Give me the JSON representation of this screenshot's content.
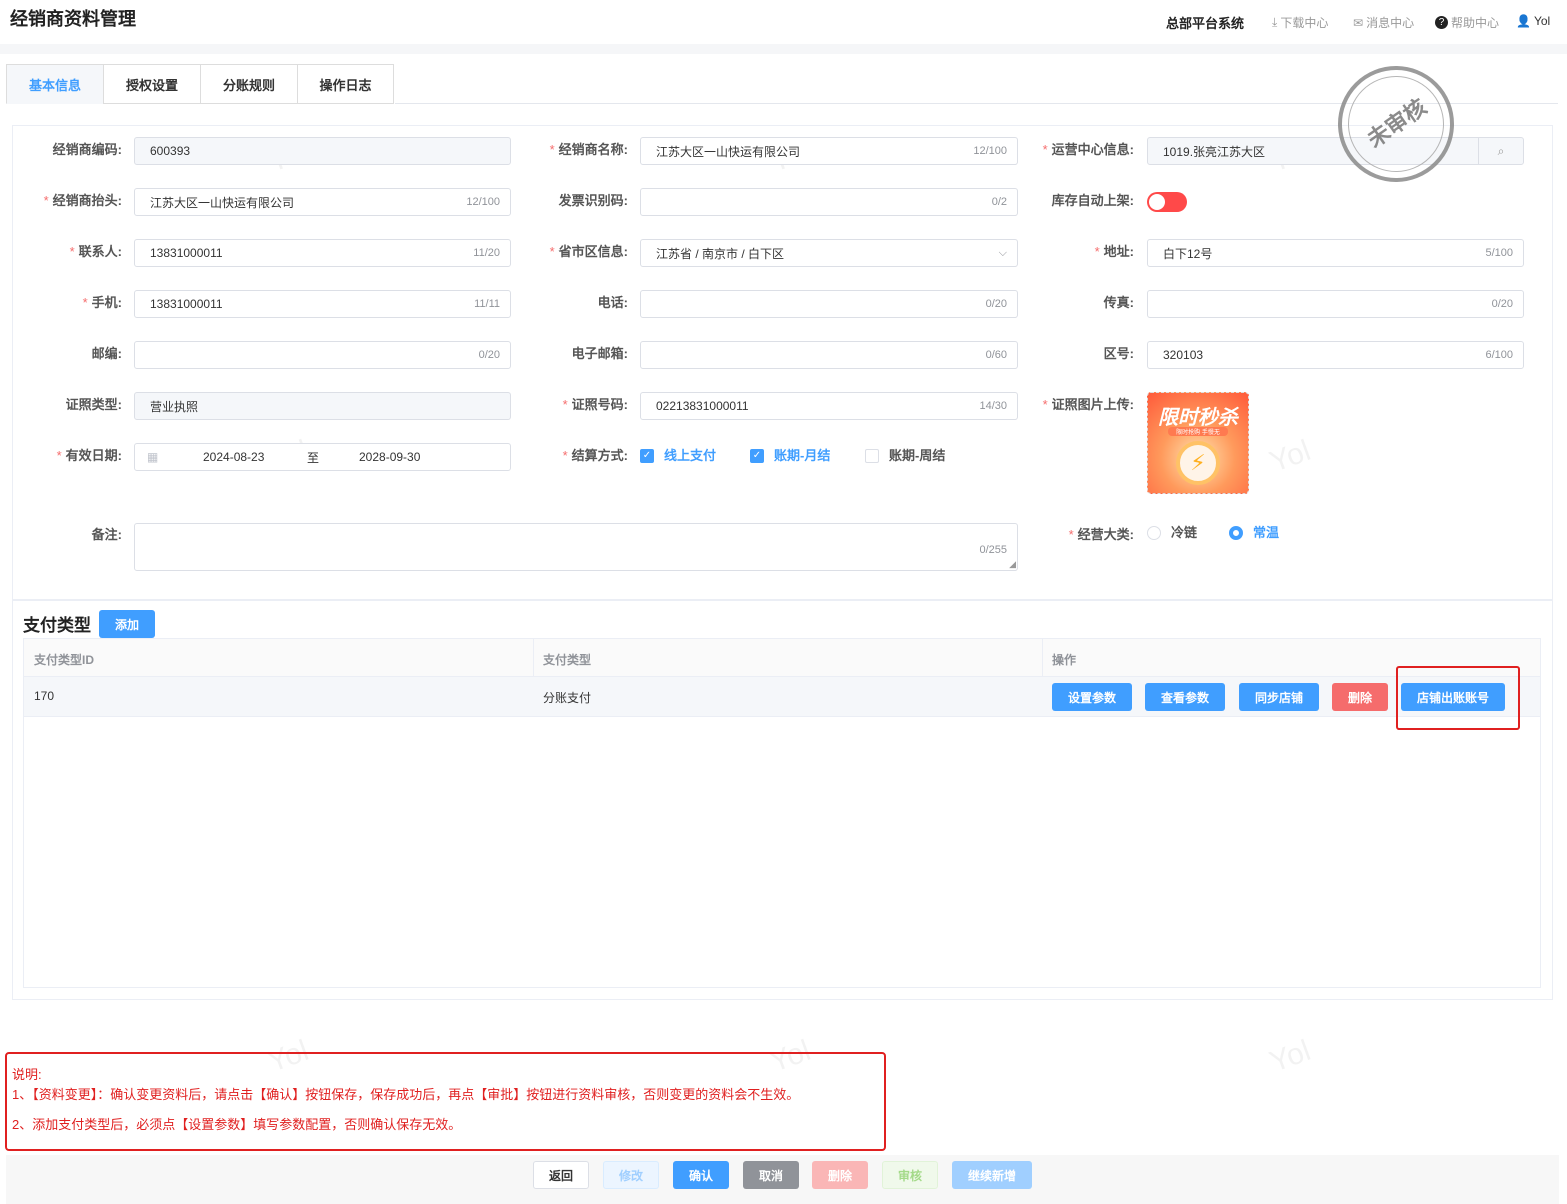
{
  "header": {
    "title": "经销商资料管理",
    "system": "总部平台系统",
    "download": "下载中心",
    "messages": "消息中心",
    "help": "帮助中心",
    "user": "Yol"
  },
  "tabs": [
    {
      "label": "基本信息",
      "active": true
    },
    {
      "label": "授权设置"
    },
    {
      "label": "分账规则"
    },
    {
      "label": "操作日志"
    }
  ],
  "stamp": "未审核",
  "watermark": "Yol",
  "form": {
    "dealer_code": {
      "label": "经销商编码:",
      "value": "600393"
    },
    "dealer_name": {
      "label": "经销商名称:",
      "value": "江苏大区一山快运有限公司",
      "count": "12/100"
    },
    "ops_center": {
      "label": "运营中心信息:",
      "value": "1019.张亮江苏大区"
    },
    "dealer_header": {
      "label": "经销商抬头:",
      "value": "江苏大区一山快运有限公司",
      "count": "12/100"
    },
    "invoice_code": {
      "label": "发票识别码:",
      "value": "",
      "count": "0/2"
    },
    "auto_shelf": {
      "label": "库存自动上架:",
      "on": false
    },
    "contact": {
      "label": "联系人:",
      "value": "13831000011",
      "count": "11/20"
    },
    "region": {
      "label": "省市区信息:",
      "value": "江苏省 / 南京市 / 白下区"
    },
    "address": {
      "label": "地址:",
      "value": "白下12号",
      "count": "5/100"
    },
    "mobile": {
      "label": "手机:",
      "value": "13831000011",
      "count": "11/11"
    },
    "phone": {
      "label": "电话:",
      "value": "",
      "count": "0/20"
    },
    "fax": {
      "label": "传真:",
      "value": "",
      "count": "0/20"
    },
    "postcode": {
      "label": "邮编:",
      "value": "",
      "count": "0/20"
    },
    "email": {
      "label": "电子邮箱:",
      "value": "",
      "count": "0/60"
    },
    "area_code": {
      "label": "区号:",
      "value": "320103",
      "count": "6/100"
    },
    "license_type": {
      "label": "证照类型:",
      "value": "营业执照"
    },
    "license_no": {
      "label": "证照号码:",
      "value": "02213831000011",
      "count": "14/30"
    },
    "license_image": {
      "label": "证照图片上传:",
      "image_text": "限时秒杀",
      "image_sub": "限时抢购 手慢无"
    },
    "valid_date": {
      "label": "有效日期:",
      "start": "2024-08-23",
      "sep": "至",
      "end": "2028-09-30"
    },
    "settlement": {
      "label": "结算方式:",
      "options": [
        {
          "label": "线上支付",
          "checked": true
        },
        {
          "label": "账期-月结",
          "checked": true
        },
        {
          "label": "账期-周结",
          "checked": false
        }
      ]
    },
    "remark": {
      "label": "备注:",
      "value": "",
      "count": "0/255"
    },
    "category": {
      "label": "经营大类:",
      "options": [
        {
          "label": "冷链",
          "checked": false
        },
        {
          "label": "常温",
          "checked": true
        }
      ]
    }
  },
  "payment": {
    "title": "支付类型",
    "add": "添加",
    "columns": [
      "支付类型ID",
      "支付类型",
      "操作"
    ],
    "rows": [
      {
        "id": "170",
        "type": "分账支付"
      }
    ],
    "actions": [
      "设置参数",
      "查看参数",
      "同步店铺",
      "删除",
      "店铺出账账号"
    ]
  },
  "note": {
    "title": "说明:",
    "lines": [
      "1、【资料变更】：确认变更资料后，请点击【确认】按钮保存，保存成功后，再点【审批】按钮进行资料审核，否则变更的资料会不生效。",
      "2、添加支付类型后，必须点【设置参数】填写参数配置，否则确认保存无效。"
    ]
  },
  "footer": {
    "back": "返回",
    "edit": "修改",
    "confirm": "确认",
    "cancel": "取消",
    "delete": "删除",
    "audit": "审核",
    "continue": "继续新增"
  },
  "colors": {
    "primary": "#409eff",
    "danger": "#f56c6c",
    "highlight": "#e02020"
  }
}
